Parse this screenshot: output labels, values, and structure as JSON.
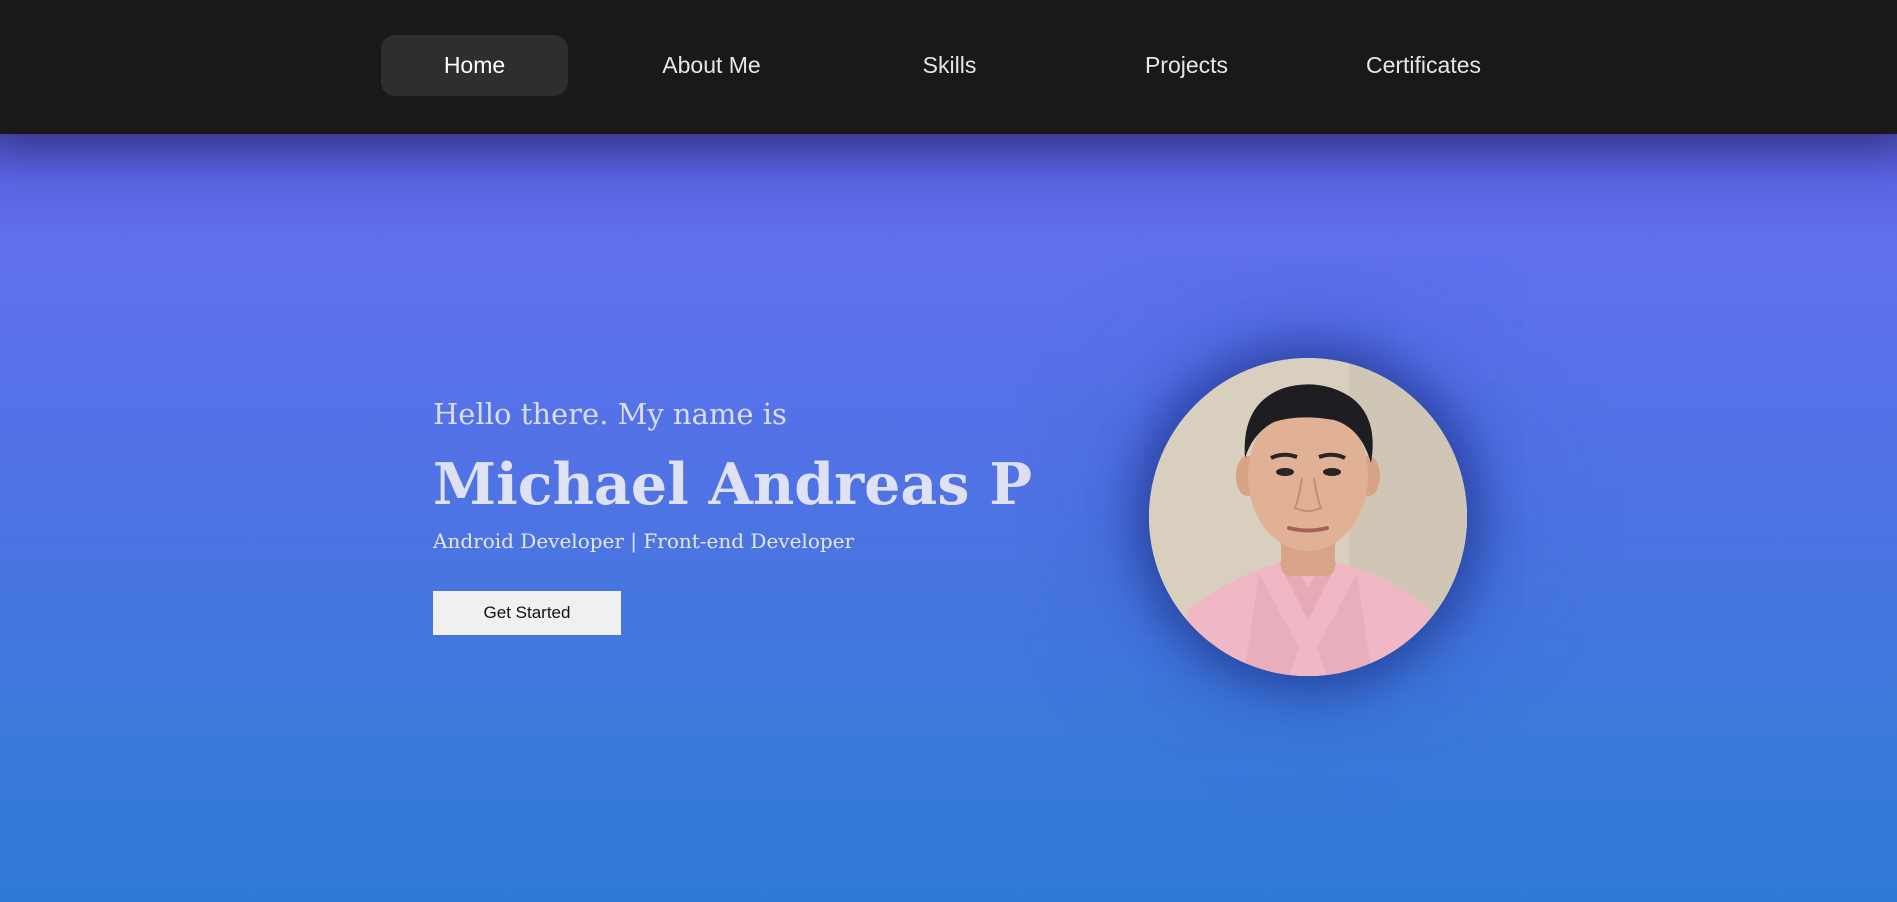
{
  "nav": {
    "items": [
      {
        "label": "Home",
        "active": true
      },
      {
        "label": "About Me",
        "active": false
      },
      {
        "label": "Skills",
        "active": false
      },
      {
        "label": "Projects",
        "active": false
      },
      {
        "label": "Certificates",
        "active": false
      }
    ]
  },
  "hero": {
    "greeting": "Hello there. My name is",
    "name": "Michael Andreas P",
    "roles": "Android Developer | Front-end Developer",
    "cta_label": "Get Started"
  },
  "colors": {
    "navbar_bg": "#191919",
    "nav_active_bg": "#2e2e2e",
    "gradient_top": "#6070ef",
    "gradient_bottom": "#2f79d6",
    "button_bg": "#f0f0f0"
  },
  "icons": {
    "profile_photo": "profile-photo"
  }
}
